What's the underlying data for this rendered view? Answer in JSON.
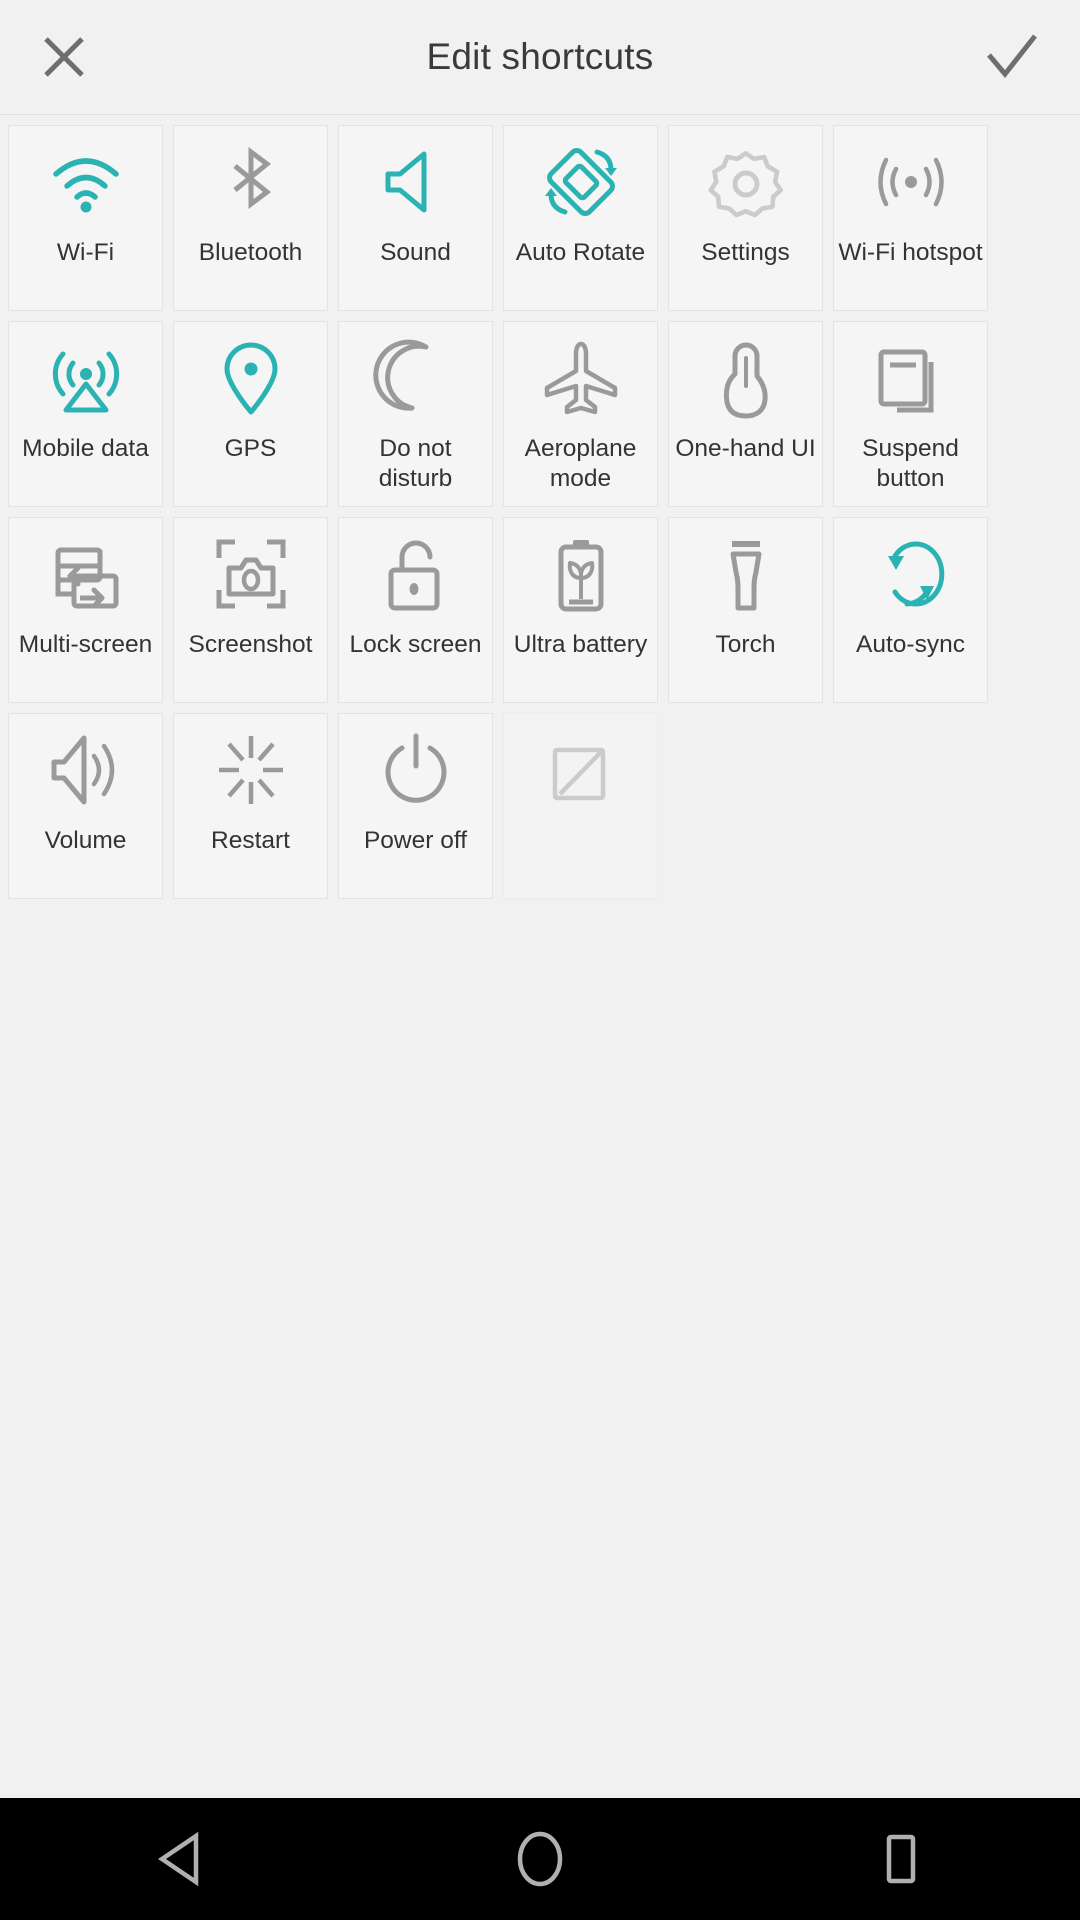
{
  "header": {
    "title": "Edit shortcuts",
    "close_icon": "close-icon",
    "confirm_icon": "check-icon"
  },
  "colors": {
    "accent_teal": "#2bb3b3",
    "icon_gray": "#9a9a9a",
    "icon_gray_light": "#cbcbcb",
    "text": "#333333",
    "tile_bg": "#f5f5f5",
    "tile_border": "#e4e4e4",
    "page_bg": "#f1f1f1",
    "navbar_bg": "#000000"
  },
  "shortcuts": [
    {
      "label": "Wi-Fi",
      "icon": "wifi-icon",
      "state": "on"
    },
    {
      "label": "Bluetooth",
      "icon": "bluetooth-icon",
      "state": "off"
    },
    {
      "label": "Sound",
      "icon": "sound-icon",
      "state": "on"
    },
    {
      "label": "Auto Rotate",
      "icon": "auto-rotate-icon",
      "state": "on"
    },
    {
      "label": "Settings",
      "icon": "gear-icon",
      "state": "disabled"
    },
    {
      "label": "Wi-Fi hotspot",
      "icon": "hotspot-icon",
      "state": "off"
    },
    {
      "label": "Mobile data",
      "icon": "mobile-data-icon",
      "state": "on"
    },
    {
      "label": "GPS",
      "icon": "location-pin-icon",
      "state": "on"
    },
    {
      "label": "Do not disturb",
      "icon": "moon-icon",
      "state": "off"
    },
    {
      "label": "Aeroplane mode",
      "icon": "aeroplane-icon",
      "state": "off"
    },
    {
      "label": "One-hand UI",
      "icon": "hand-icon",
      "state": "off"
    },
    {
      "label": "Suspend button",
      "icon": "suspend-window-icon",
      "state": "off"
    },
    {
      "label": "Multi-screen",
      "icon": "multi-screen-icon",
      "state": "off"
    },
    {
      "label": "Screenshot",
      "icon": "camera-frame-icon",
      "state": "off"
    },
    {
      "label": "Lock screen",
      "icon": "padlock-open-icon",
      "state": "off"
    },
    {
      "label": "Ultra battery",
      "icon": "battery-plant-icon",
      "state": "off"
    },
    {
      "label": "Torch",
      "icon": "torch-icon",
      "state": "off"
    },
    {
      "label": "Auto-sync",
      "icon": "sync-icon",
      "state": "on"
    },
    {
      "label": "Volume",
      "icon": "volume-icon",
      "state": "off"
    },
    {
      "label": "Restart",
      "icon": "restart-burst-icon",
      "state": "off"
    },
    {
      "label": "Power off",
      "icon": "power-icon",
      "state": "off"
    },
    {
      "label": "",
      "icon": "placeholder-icon",
      "state": "placeholder"
    }
  ],
  "navbar": {
    "back_label": "back-icon",
    "home_label": "home-icon",
    "recents_label": "recents-icon"
  }
}
